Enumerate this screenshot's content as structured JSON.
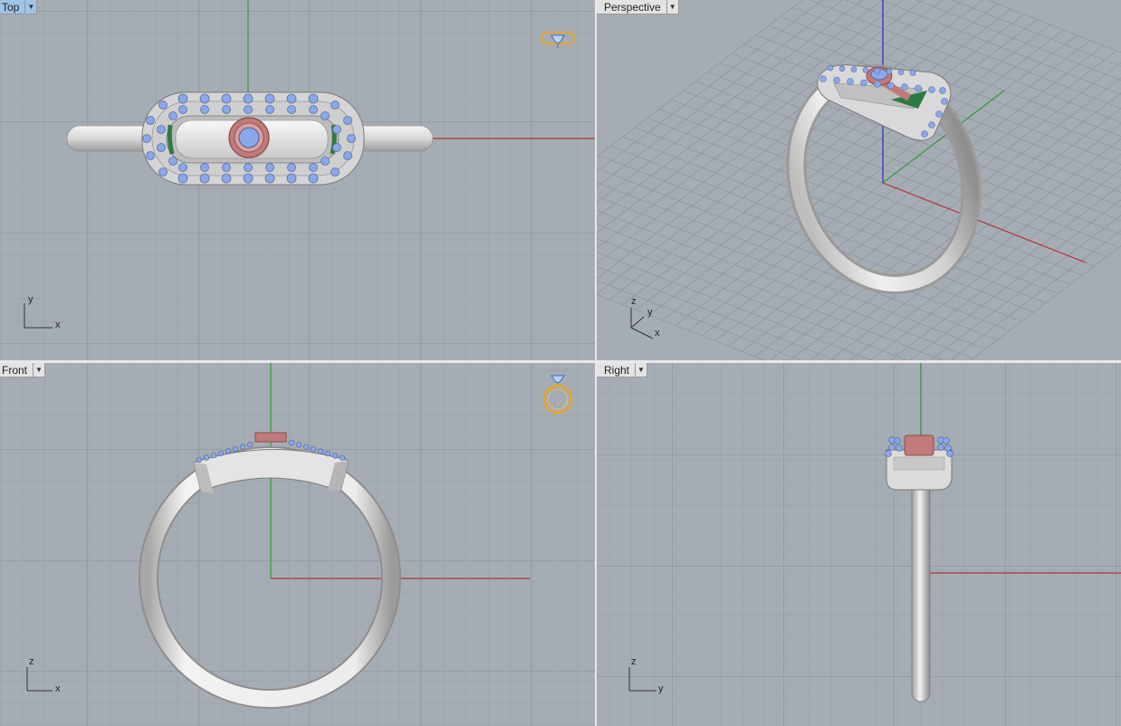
{
  "viewports": {
    "top": {
      "label": "Top",
      "axis_h": "x",
      "axis_v": "y"
    },
    "perspective": {
      "label": "Perspective",
      "axis_z": "z",
      "axis_y": "y",
      "axis_x": "x"
    },
    "front": {
      "label": "Front",
      "axis_h": "x",
      "axis_v": "z"
    },
    "right": {
      "label": "Right",
      "axis_h": "y",
      "axis_v": "z"
    }
  },
  "icons": {
    "dropdown": "chevron-down-icon",
    "ring_top_view": "ring-top-view-icon",
    "ring_front_view": "ring-front-view-icon"
  },
  "colors": {
    "viewport_bg": "#a6acb3",
    "grid_minor": "#99a0a8",
    "grid_major": "#8a9199",
    "x_axis": "#b13434",
    "y_axis": "#2f9a3a",
    "z_axis": "#2a2ad0",
    "metal": "#e2e2e2",
    "stone_blue": "#8aa8e8",
    "center_stone": "#c07a7a",
    "active_label": "#9ec3e6",
    "icon_gold": "#e8a52a"
  }
}
